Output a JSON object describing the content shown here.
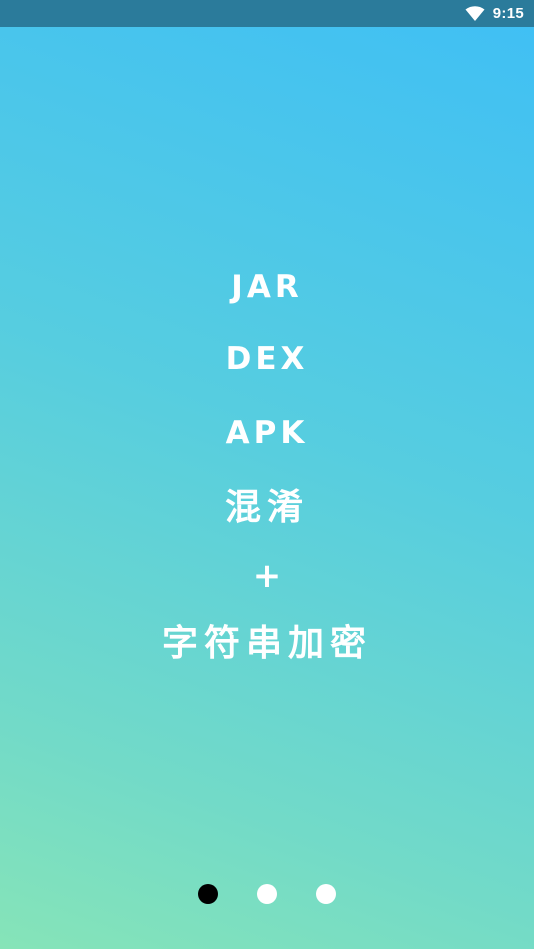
{
  "status_bar": {
    "time": "9:15",
    "wifi_icon": "wifi-icon"
  },
  "content": {
    "lines": [
      "JAR",
      "DEX",
      "APK",
      "混淆",
      "+",
      "字符串加密"
    ]
  },
  "page_indicator": {
    "total": 3,
    "current": 1
  },
  "colors": {
    "status_bar": "#2b7b9b",
    "gradient_top": "#3fbff5",
    "gradient_bottom": "#86e4b8",
    "text": "#ffffff",
    "active_dot": "#000000",
    "inactive_dot": "#ffffff"
  }
}
